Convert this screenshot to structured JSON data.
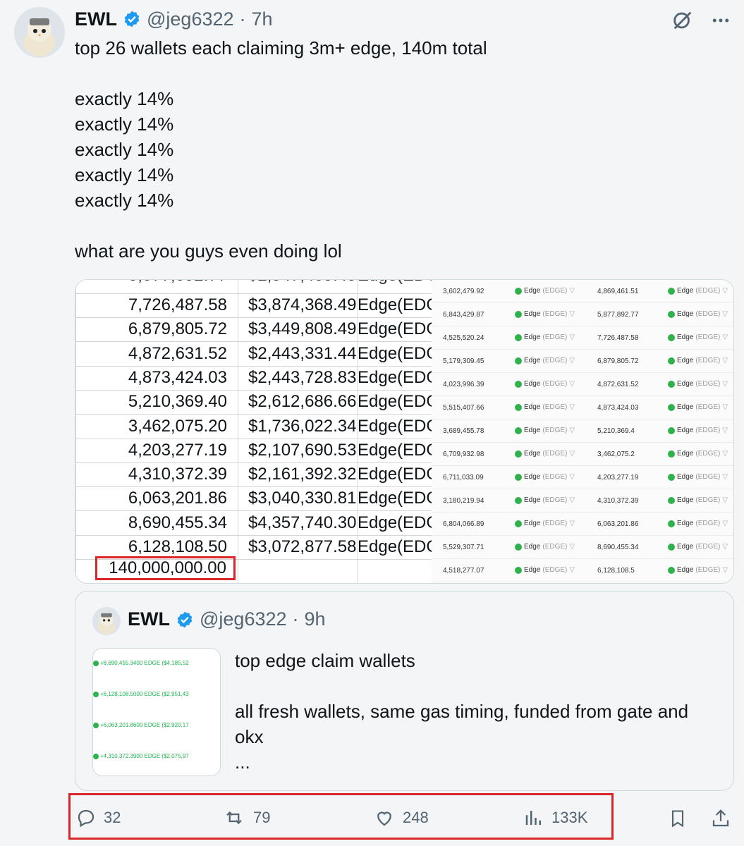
{
  "author": {
    "name": "EWL",
    "handle": "@jeg6322",
    "time": "7h"
  },
  "tweet": {
    "text": "top 26 wallets each claiming 3m+ edge, 140m total\n\nexactly 14%\nexactly 14%\nexactly 14%\nexactly 14%\nexactly 14%\n\nwhat are you guys even doing lol"
  },
  "media": {
    "sheet_rows": [
      {
        "amount": "7,726,487.58",
        "usd": "$3,874,368.49",
        "token": "Edge(EDG"
      },
      {
        "amount": "6,879,805.72",
        "usd": "$3,449,808.49",
        "token": "Edge(EDG"
      },
      {
        "amount": "4,872,631.52",
        "usd": "$2,443,331.44",
        "token": "Edge(EDG"
      },
      {
        "amount": "4,873,424.03",
        "usd": "$2,443,728.83",
        "token": "Edge(EDG"
      },
      {
        "amount": "5,210,369.40",
        "usd": "$2,612,686.66",
        "token": "Edge(EDG"
      },
      {
        "amount": "3,462,075.20",
        "usd": "$1,736,022.34",
        "token": "Edge(EDG"
      },
      {
        "amount": "4,203,277.19",
        "usd": "$2,107,690.53",
        "token": "Edge(EDG"
      },
      {
        "amount": "4,310,372.39",
        "usd": "$2,161,392.32",
        "token": "Edge(EDG"
      },
      {
        "amount": "6,063,201.86",
        "usd": "$3,040,330.81",
        "token": "Edge(EDG"
      },
      {
        "amount": "8,690,455.34",
        "usd": "$4,357,740.30",
        "token": "Edge(EDG"
      },
      {
        "amount": "6,128,108.50",
        "usd": "$3,072,877.58",
        "token": "Edge(EDG"
      }
    ],
    "sheet_total": "140,000,000.00",
    "ledger_token": "Edge",
    "ledger_token_sub": "(EDGE)",
    "ledger_rows": [
      {
        "left": "3,602,479.92",
        "right": "4,869,461.51"
      },
      {
        "left": "6,843,429.87",
        "right": "5,877,892.77"
      },
      {
        "left": "4,525,520.24",
        "right": "7,726,487.58"
      },
      {
        "left": "5,179,309.45",
        "right": "6,879,805.72"
      },
      {
        "left": "4,023,996.39",
        "right": "4,872,631.52"
      },
      {
        "left": "5,515,407.66",
        "right": "4,873,424.03"
      },
      {
        "left": "3,689,455.78",
        "right": "5,210,369.4"
      },
      {
        "left": "6,709,932.98",
        "right": "3,462,075.2"
      },
      {
        "left": "6,711,033.09",
        "right": "4,203,277.19"
      },
      {
        "left": "3,180,219.94",
        "right": "4,310,372.39"
      },
      {
        "left": "6,804,066.89",
        "right": "6,063,201.86"
      },
      {
        "left": "5,529,307.71",
        "right": "8,690,455.34"
      },
      {
        "left": "4,518,277.07",
        "right": "6,128,108.5"
      }
    ]
  },
  "quote": {
    "name": "EWL",
    "handle": "@jeg6322",
    "time": "9h",
    "text": "top edge claim wallets\n\nall fresh wallets, same gas timing, funded from gate and okx\n...",
    "thumb_lines": [
      "+8,690,455.3400 EDGE ($4,185,52",
      "+6,128,108.5000 EDGE ($2,951,43",
      "+6,063,201.8600 EDGE ($2,920,17",
      "+4,310,372.3900 EDGE ($2,075,97"
    ]
  },
  "actions": {
    "replies": "32",
    "reposts": "79",
    "likes": "248",
    "views": "133K"
  },
  "colors": {
    "accent": "#1d9bf0",
    "highlight": "#d9262a",
    "muted": "#536471"
  }
}
